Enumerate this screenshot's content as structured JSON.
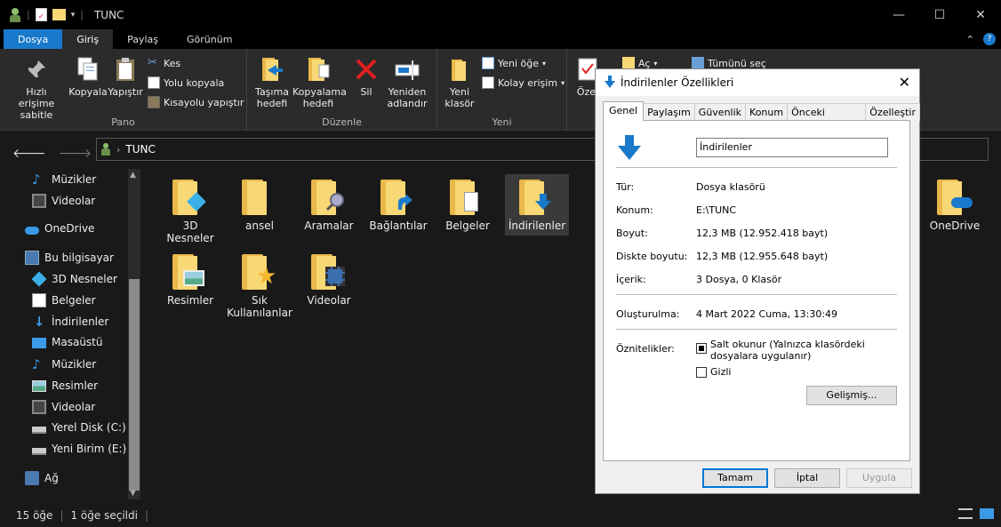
{
  "window": {
    "title": "TUNC",
    "controls": {
      "minimize": "—",
      "maximize": "☐",
      "close": "✕"
    }
  },
  "ribbon_tabs": {
    "file": "Dosya",
    "home": "Giriş",
    "share": "Paylaş",
    "view": "Görünüm"
  },
  "ribbon": {
    "pin_label": "Hızlı erişime sabitle",
    "copy_label": "Kopyala",
    "paste_label": "Yapıştır",
    "cut_label": "Kes",
    "copy_path_label": "Yolu kopyala",
    "paste_shortcut_label": "Kısayolu yapıştır",
    "clipboard_group": "Pano",
    "move_to_label": "Taşıma hedefi",
    "copy_to_label": "Kopyalama hedefi",
    "delete_label": "Sil",
    "rename_label": "Yeniden adlandır",
    "organize_group": "Düzenle",
    "new_folder_label": "Yeni klasör",
    "new_item_label": "Yeni öğe",
    "easy_access_label": "Kolay erişim",
    "new_group": "Yeni",
    "properties_label": "Özel",
    "open_label": "Aç",
    "select_all_label": "Tümünü seç"
  },
  "address": {
    "path": "TUNC"
  },
  "sidebar": {
    "music_top": "Müzikler",
    "videos_top": "Videolar",
    "onedrive": "OneDrive",
    "this_pc": "Bu bilgisayar",
    "objects3d": "3D Nesneler",
    "documents": "Belgeler",
    "downloads": "İndirilenler",
    "desktop": "Masaüstü",
    "music": "Müzikler",
    "pictures": "Resimler",
    "videos": "Videolar",
    "local_disk": "Yerel Disk (C:)",
    "new_volume": "Yeni Birim (E:)",
    "network": "Ağ"
  },
  "files": {
    "objects3d": "3D Nesneler",
    "ansel": "ansel",
    "searches": "Aramalar",
    "links": "Bağlantılar",
    "documents": "Belgeler",
    "downloads": "İndirilenler",
    "onedrive": "OneDrive",
    "pictures": "Resimler",
    "favorites": "Sık Kullanılanlar",
    "videos": "Videolar"
  },
  "status": {
    "count": "15 öğe",
    "selected": "1 öğe seçildi"
  },
  "dialog": {
    "title": "İndirilenler Özellikleri",
    "tabs": {
      "general": "Genel",
      "sharing": "Paylaşım",
      "security": "Güvenlik",
      "location": "Konum",
      "previous": "Önceki Sürümler",
      "customize": "Özelleştir"
    },
    "name": "İndirilenler",
    "type_label": "Tür:",
    "type_value": "Dosya klasörü",
    "location_label": "Konum:",
    "location_value": "E:\\TUNC",
    "size_label": "Boyut:",
    "size_value": "12,3 MB (12.952.418 bayt)",
    "disk_size_label": "Diskte boyutu:",
    "disk_size_value": "12,3 MB (12.955.648 bayt)",
    "contains_label": "İçerik:",
    "contains_value": "3 Dosya, 0 Klasör",
    "created_label": "Oluşturulma:",
    "created_value": "4 Mart 2022 Cuma, 13:30:49",
    "attributes_label": "Öznitelikler:",
    "readonly_label": "Salt okunur (Yalnızca klasördeki dosyalara uygulanır)",
    "hidden_label": "Gizli",
    "advanced_button": "Gelişmiş...",
    "ok_button": "Tamam",
    "cancel_button": "İptal",
    "apply_button": "Uygula"
  }
}
